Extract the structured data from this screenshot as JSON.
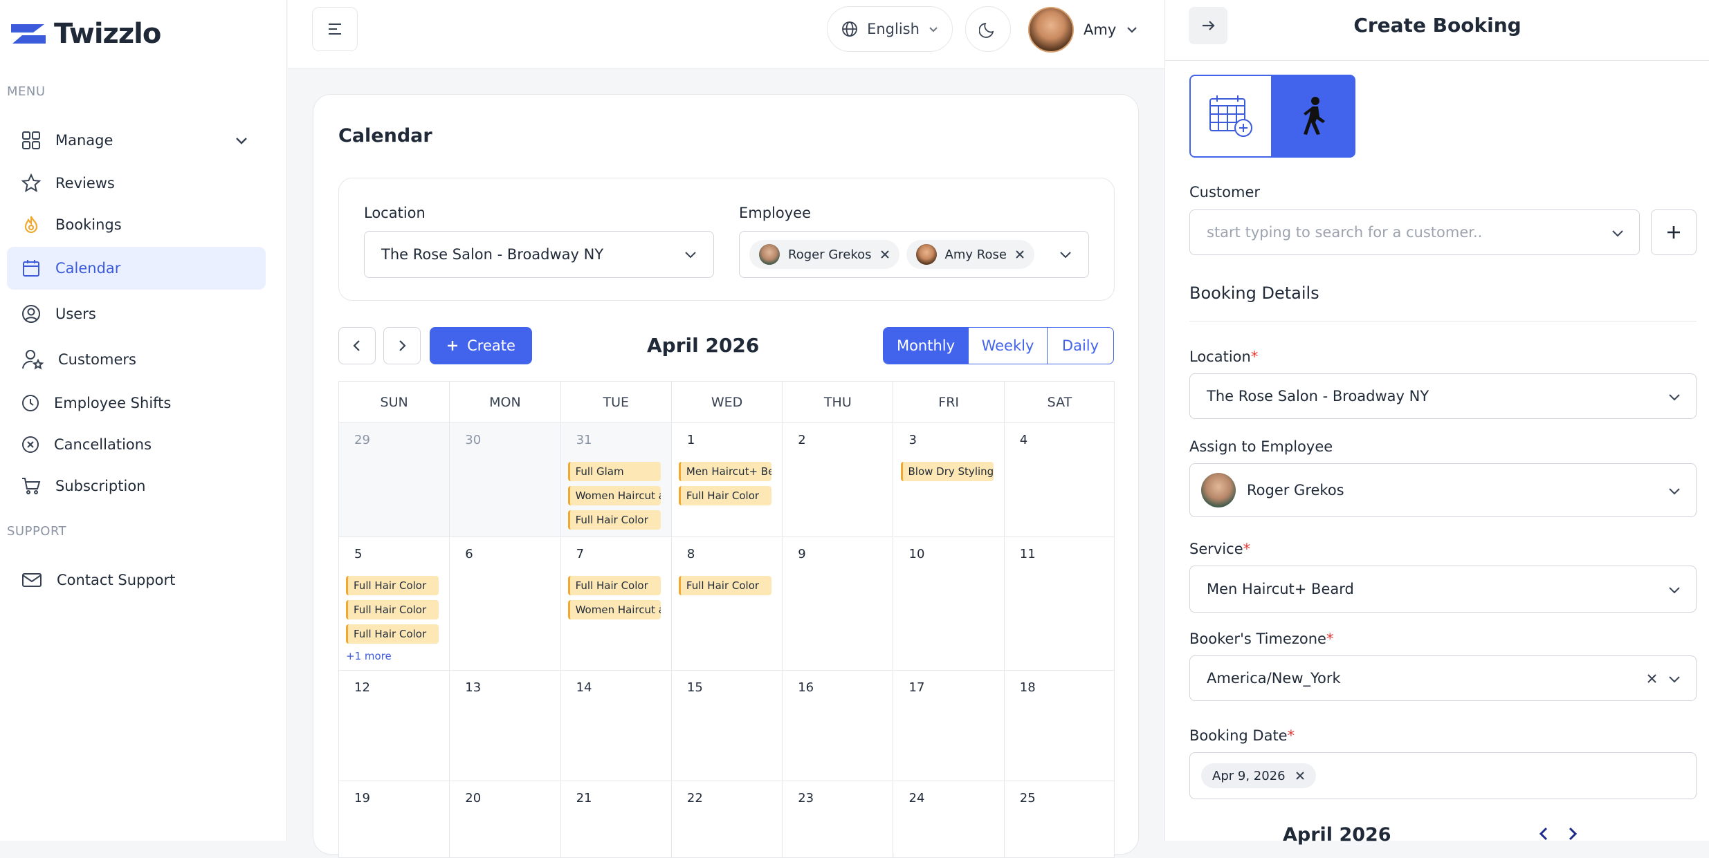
{
  "app": {
    "name": "Twizzlo"
  },
  "sidebar": {
    "menu_heading": "MENU",
    "support_heading": "SUPPORT",
    "items": [
      {
        "label": "Manage",
        "icon": "grid-icon"
      },
      {
        "label": "Reviews",
        "icon": "star-icon"
      },
      {
        "label": "Bookings",
        "icon": "flame-icon"
      },
      {
        "label": "Calendar",
        "icon": "calendar-icon",
        "active": true
      },
      {
        "label": "Users",
        "icon": "user-circle-icon"
      },
      {
        "label": "Customers",
        "icon": "user-star-icon"
      },
      {
        "label": "Employee Shifts",
        "icon": "clock-icon"
      },
      {
        "label": "Cancellations",
        "icon": "x-circle-icon"
      },
      {
        "label": "Subscription",
        "icon": "cart-icon"
      }
    ],
    "support_items": [
      {
        "label": "Contact Support",
        "icon": "mail-icon"
      }
    ]
  },
  "topbar": {
    "language": "English",
    "user_name": "Amy"
  },
  "calendar": {
    "title": "Calendar",
    "location_label": "Location",
    "location_value": "The Rose Salon - Broadway NY",
    "employee_label": "Employee",
    "employees": [
      "Roger Grekos",
      "Amy Rose"
    ],
    "create_label": "Create",
    "month_title": "April 2026",
    "views": [
      "Monthly",
      "Weekly",
      "Daily"
    ],
    "active_view": "Monthly",
    "day_headers": [
      "SUN",
      "MON",
      "TUE",
      "WED",
      "THU",
      "FRI",
      "SAT"
    ],
    "weeks": [
      [
        {
          "day": "29",
          "muted": true,
          "events": []
        },
        {
          "day": "30",
          "muted": true,
          "events": []
        },
        {
          "day": "31",
          "muted": true,
          "events": [
            "Full Glam",
            "Women Haircut and",
            "Full Hair Color"
          ]
        },
        {
          "day": "1",
          "events": [
            "Men Haircut+ Beard",
            "Full Hair Color"
          ]
        },
        {
          "day": "2",
          "events": []
        },
        {
          "day": "3",
          "events": [
            "Blow Dry Styling"
          ]
        },
        {
          "day": "4",
          "events": []
        }
      ],
      [
        {
          "day": "5",
          "events": [
            "Full Hair Color",
            "Full Hair Color",
            "Full Hair Color"
          ],
          "more": "+1 more"
        },
        {
          "day": "6",
          "events": []
        },
        {
          "day": "7",
          "events": [
            "Full Hair Color",
            "Women Haircut and"
          ]
        },
        {
          "day": "8",
          "events": [
            "Full Hair Color"
          ]
        },
        {
          "day": "9",
          "events": []
        },
        {
          "day": "10",
          "events": []
        },
        {
          "day": "11",
          "events": []
        }
      ],
      [
        {
          "day": "12",
          "events": []
        },
        {
          "day": "13",
          "events": []
        },
        {
          "day": "14",
          "events": []
        },
        {
          "day": "15",
          "events": []
        },
        {
          "day": "16",
          "events": []
        },
        {
          "day": "17",
          "events": []
        },
        {
          "day": "18",
          "events": []
        }
      ],
      [
        {
          "day": "19",
          "events": []
        },
        {
          "day": "20",
          "events": []
        },
        {
          "day": "21",
          "events": []
        },
        {
          "day": "22",
          "events": []
        },
        {
          "day": "23",
          "events": []
        },
        {
          "day": "24",
          "events": []
        },
        {
          "day": "25",
          "events": []
        }
      ]
    ]
  },
  "booking_panel": {
    "title": "Create Booking",
    "customer_label": "Customer",
    "customer_placeholder": "start typing to search for a customer..",
    "details_heading": "Booking Details",
    "location_label": "Location",
    "location_value": "The Rose Salon - Broadway NY",
    "employee_label": "Assign to Employee",
    "employee_value": "Roger Grekos",
    "service_label": "Service",
    "service_value": "Men Haircut+ Beard",
    "timezone_label": "Booker's Timezone",
    "timezone_value": "America/New_York",
    "date_label": "Booking Date",
    "date_value": "Apr 9, 2026",
    "mini_month": "April 2026"
  },
  "colors": {
    "accent": "#4263eb",
    "event_bg": "#fde8b5",
    "event_border": "#f0a830",
    "required": "#e53935"
  }
}
